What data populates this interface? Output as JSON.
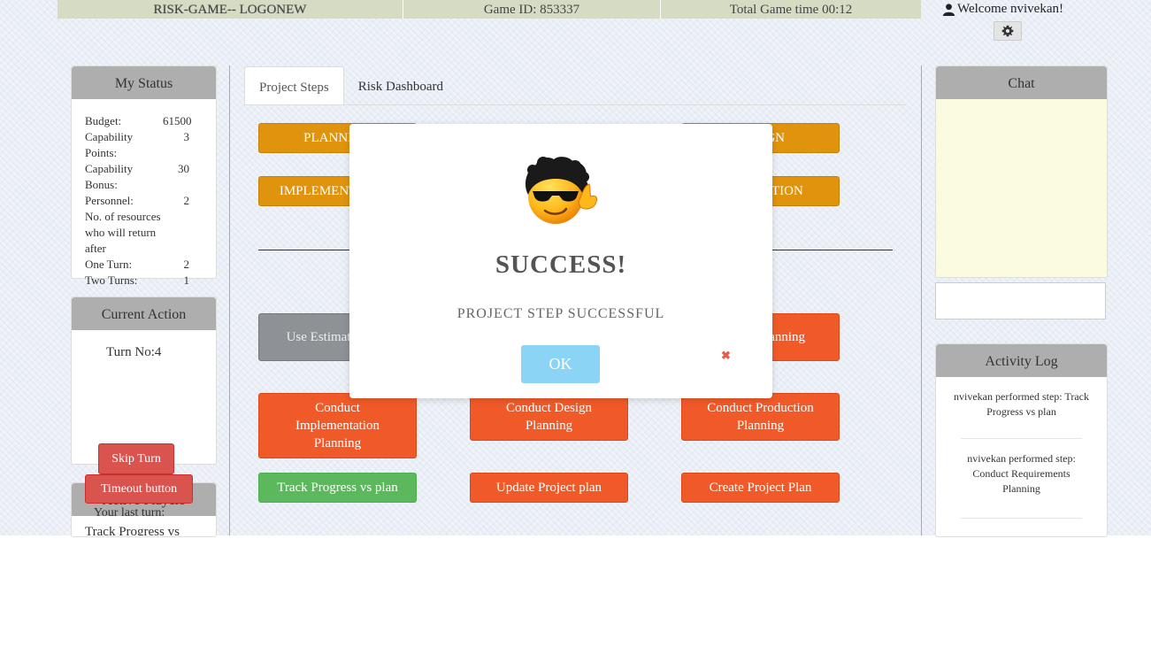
{
  "header": {
    "logo": "RISK-GAME-- LOGONEW",
    "game_id": "Game ID: 853337",
    "total_time": "Total Game time 00:12",
    "welcome": "Welcome  nvivekan!",
    "user_icon": "user-icon",
    "settings_icon": "gear-icon"
  },
  "my_status": {
    "title": "My Status",
    "rows": [
      {
        "label": "Budget:",
        "value": "61500"
      },
      {
        "label": "Capability Points:",
        "value": "3"
      },
      {
        "label": "Capability Bonus:",
        "value": "30"
      },
      {
        "label": "Personnel:",
        "value": "2"
      },
      {
        "label": "No. of resources who will return after",
        "value": ""
      },
      {
        "label": "One Turn:",
        "value": "2"
      },
      {
        "label": "Two Turns:",
        "value": "1"
      }
    ]
  },
  "current_action": {
    "title": "Current Action",
    "turn": "Turn No:4",
    "skip": "Skip Turn",
    "timeout": "Timeout button"
  },
  "active_players": {
    "title": "Active Players",
    "last_turn_label": "Your last turn:",
    "last_turn_value": "Track Progress vs"
  },
  "tabs": [
    "Project Steps",
    "Risk Dashboard"
  ],
  "steps": {
    "planning": "PLANNING",
    "design": "DESIGN",
    "implementation": "IMPLEMENTATION",
    "production": "PRODUCTION",
    "use_estimates": "Use Estimates Plan",
    "testing": "Testing Planning",
    "conduct_impl": "Conduct Implementation Planning",
    "conduct_design": "Conduct Design Planning",
    "conduct_prod": "Conduct Production Planning",
    "track": "Track Progress vs plan",
    "update": "Update Project plan",
    "create": "Create Project Plan"
  },
  "modal": {
    "title": "SUCCESS!",
    "text": "PROJECT STEP SUCCESSFUL",
    "ok": "OK",
    "close_icon": "close-icon"
  },
  "chat": {
    "title": "Chat"
  },
  "activity_log": {
    "title": "Activity Log",
    "items": [
      "nvivekan performed step: Track Progress vs plan",
      "nvivekan performed step: Conduct Requirements Planning"
    ]
  },
  "colors": {
    "orange": "#e0930d",
    "red": "#f05a28",
    "green": "#5cb85c",
    "ok_blue": "#8cd4f5"
  }
}
